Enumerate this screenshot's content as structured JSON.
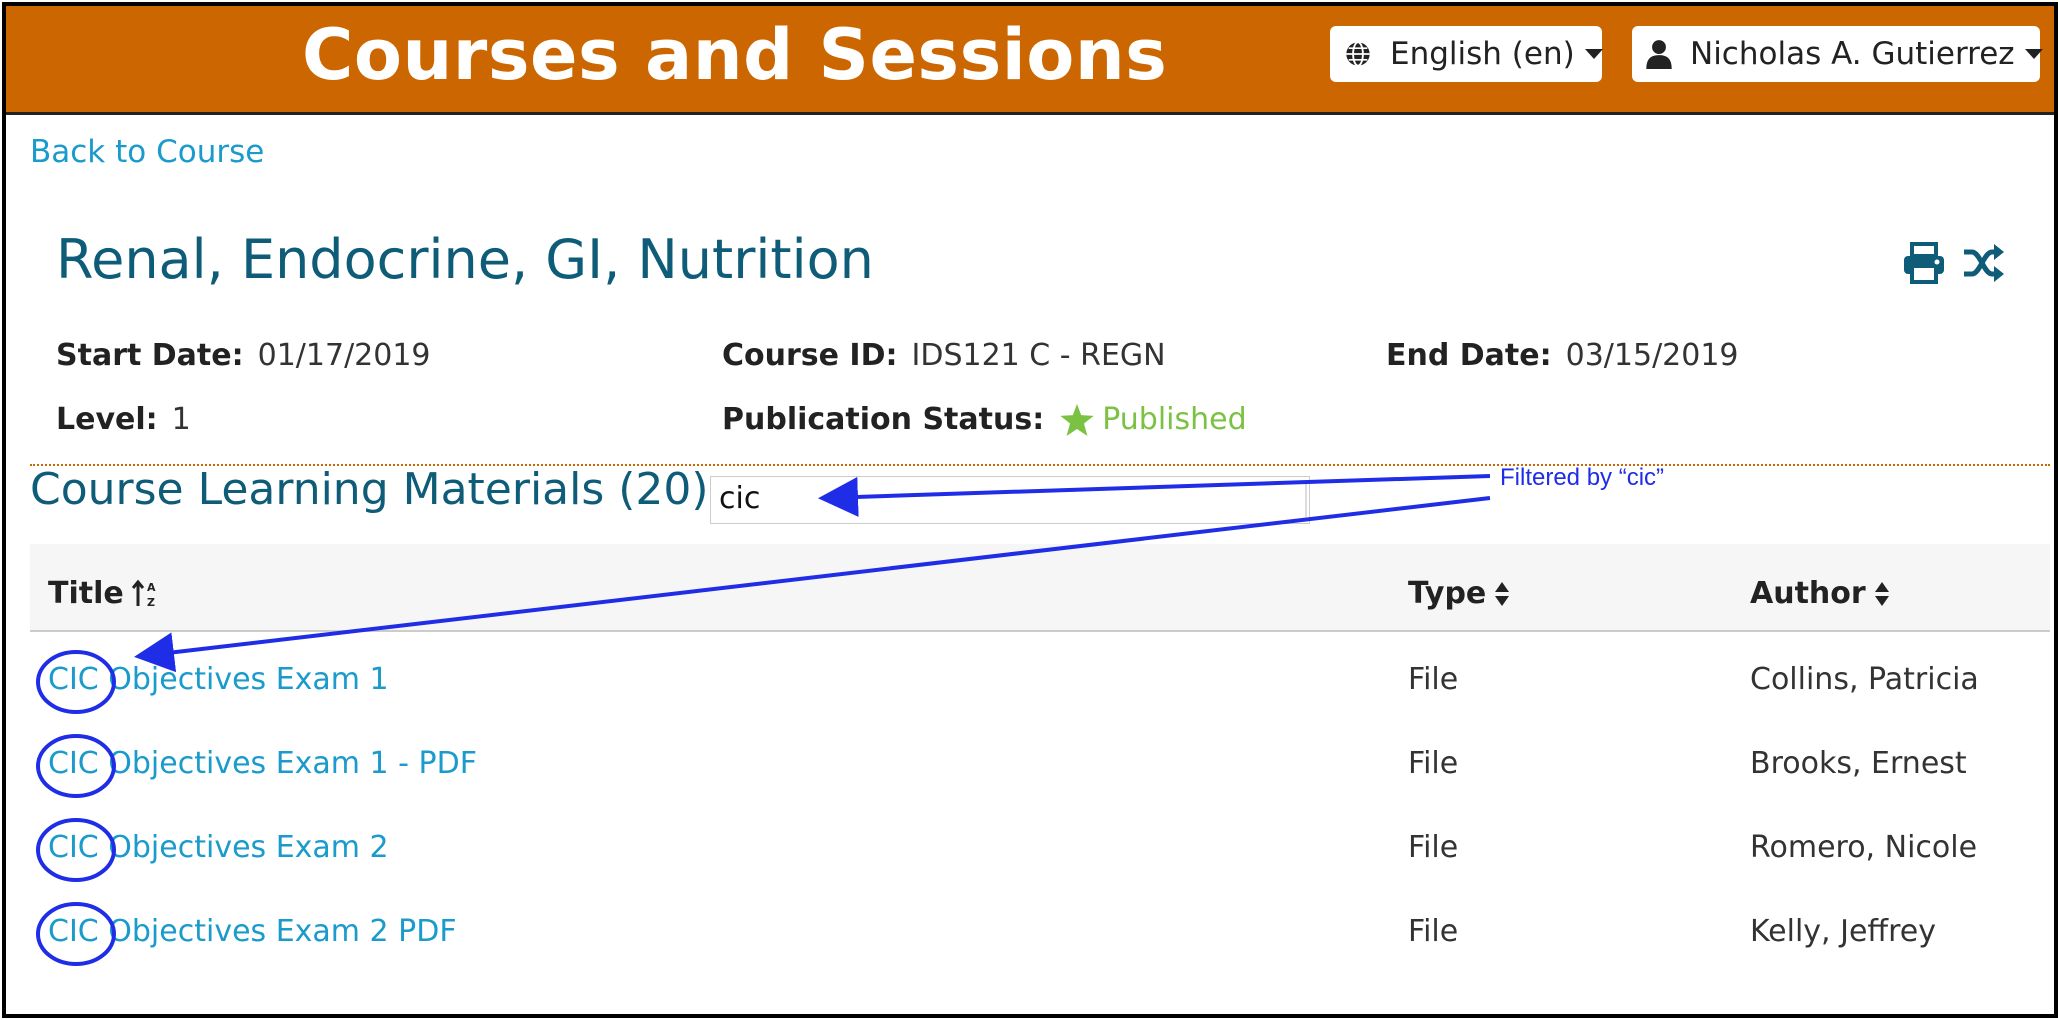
{
  "header": {
    "app_title": "Courses and Sessions",
    "language": {
      "label": "English (en)",
      "icon": "globe-icon"
    },
    "user": {
      "label": "Nicholas A. Gutierrez",
      "icon": "user-icon"
    },
    "bar_color": "#cc6600"
  },
  "nav": {
    "back_label": "Back to Course"
  },
  "course": {
    "title": "Renal, Endocrine, GI, Nutrition",
    "start_date_label": "Start Date:",
    "start_date": "01/17/2019",
    "course_id_label": "Course ID:",
    "course_id": "IDS121 C - REGN",
    "end_date_label": "End Date:",
    "end_date": "03/15/2019",
    "level_label": "Level:",
    "level": "1",
    "publication_label": "Publication Status:",
    "publication_status": "Published",
    "tools": [
      "print-icon",
      "shuffle-icon"
    ]
  },
  "materials": {
    "heading": "Course Learning Materials (20)",
    "filter_value": "cic",
    "columns": {
      "title": "Title",
      "type": "Type",
      "author": "Author"
    },
    "rows": [
      {
        "title": "CIC Objectives Exam 1",
        "type": "File",
        "author": "Collins, Patricia"
      },
      {
        "title": "CIC Objectives Exam 1 - PDF",
        "type": "File",
        "author": "Brooks, Ernest"
      },
      {
        "title": "CIC Objectives Exam 2",
        "type": "File",
        "author": "Romero, Nicole"
      },
      {
        "title": "CIC Objectives Exam 2 PDF",
        "type": "File",
        "author": "Kelly, Jeffrey"
      }
    ]
  },
  "annotation": {
    "label": "Filtered by “cic”",
    "color": "#1f2de6"
  },
  "colors": {
    "link": "#1a9bcb",
    "heading": "#0f5c79",
    "published": "#7cc242"
  }
}
